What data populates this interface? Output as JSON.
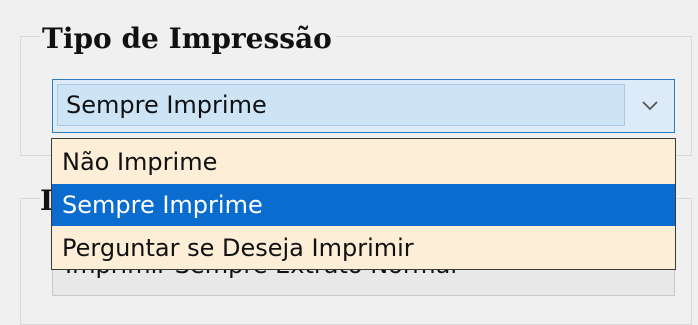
{
  "group_tipo_impressao": {
    "title": "Tipo de Impressão",
    "combo": {
      "selected_value": "Sempre Imprime",
      "options": [
        "Não Imprime",
        "Sempre Imprime",
        "Perguntar se Deseja Imprimir"
      ],
      "highlighted_option": "Sempre Imprime"
    }
  },
  "group_second": {
    "title_partial": "I",
    "combo_value": "Imprimir Sempre Extrato Normal"
  },
  "icons": {
    "dropdown_arrow": "chevron-down-icon"
  },
  "colors": {
    "selection": "#0a6ccf",
    "dropdown_bg": "#fdeed8",
    "combo_focus_bg": "#cde4f7"
  }
}
